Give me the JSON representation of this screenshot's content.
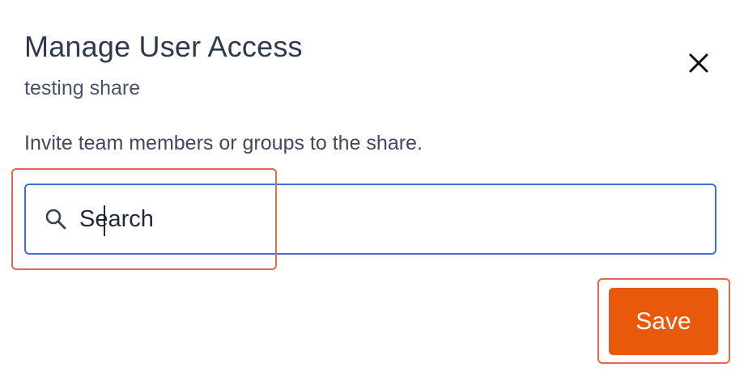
{
  "dialog": {
    "title": "Manage User Access",
    "subtitle": "testing share",
    "description": "Invite team members or groups to the share.",
    "close_icon": "close-icon"
  },
  "search": {
    "placeholder": "Search",
    "value": "",
    "icon": "search-icon",
    "border_color": "#3d6fd9"
  },
  "actions": {
    "save_label": "Save",
    "save_color": "#e8590c"
  },
  "annotations": {
    "highlight_color": "#e8664a"
  }
}
